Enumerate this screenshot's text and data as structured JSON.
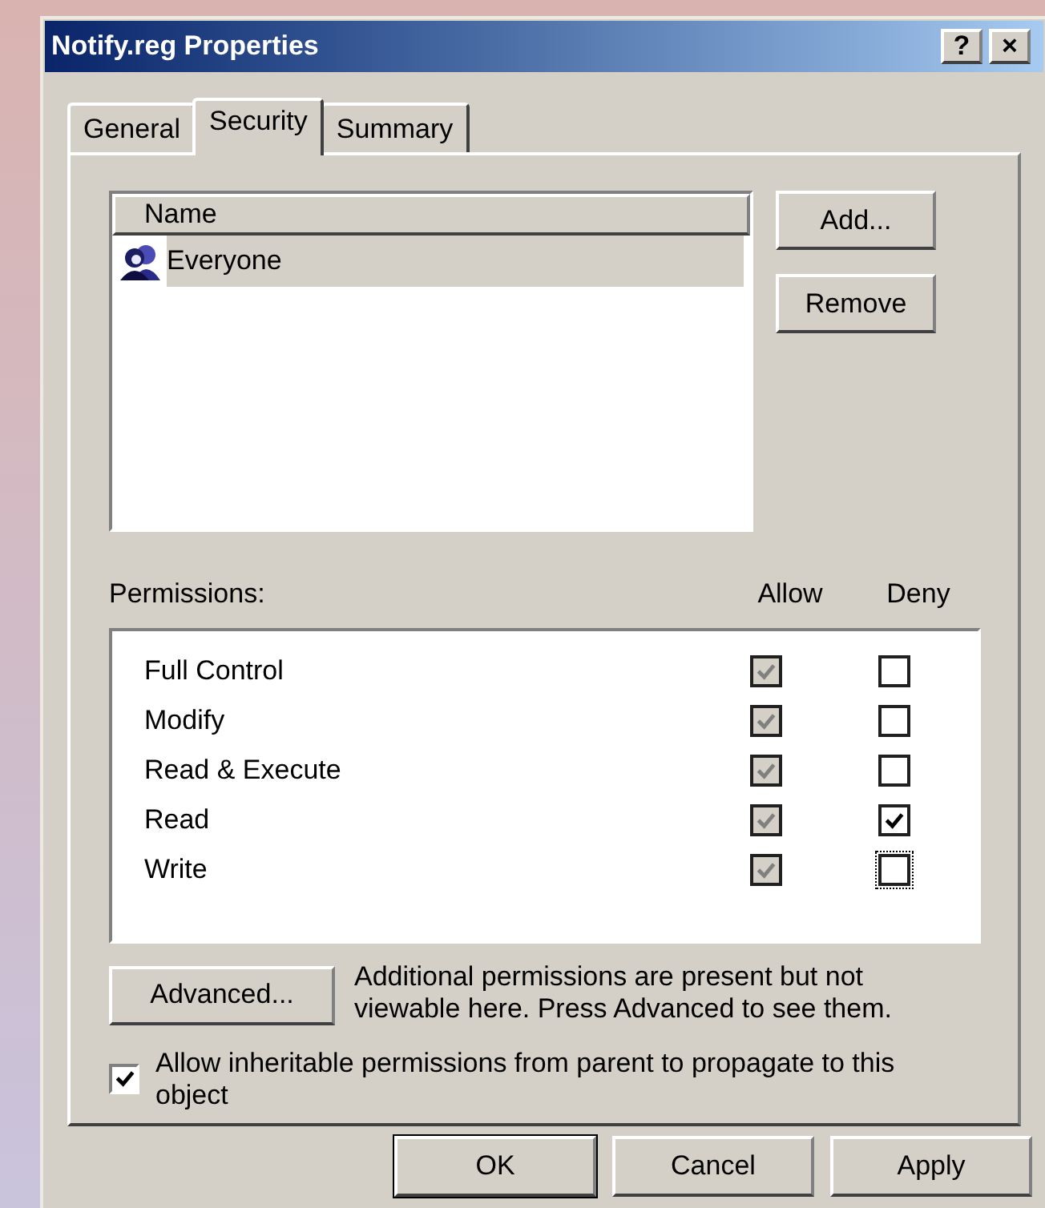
{
  "window": {
    "title": "Notify.reg Properties",
    "controls": [
      "?",
      "×"
    ]
  },
  "tabs": [
    {
      "label": "General",
      "selected": false
    },
    {
      "label": "Security",
      "selected": true
    },
    {
      "label": "Summary",
      "selected": false
    }
  ],
  "names": {
    "column": "Name",
    "items": [
      {
        "label": "Everyone",
        "selected": true
      }
    ]
  },
  "name_buttons": [
    "Add...",
    "Remove"
  ],
  "permissions": {
    "label": "Permissions:",
    "allow_heading": "Allow",
    "deny_heading": "Deny",
    "rows": [
      {
        "name": "Full Control",
        "allow": {
          "checked": true,
          "disabled": true
        },
        "deny": {
          "checked": false,
          "focused": false
        }
      },
      {
        "name": "Modify",
        "allow": {
          "checked": true,
          "disabled": true
        },
        "deny": {
          "checked": false,
          "focused": false
        }
      },
      {
        "name": "Read & Execute",
        "allow": {
          "checked": true,
          "disabled": true
        },
        "deny": {
          "checked": false,
          "focused": false
        }
      },
      {
        "name": "Read",
        "allow": {
          "checked": true,
          "disabled": true
        },
        "deny": {
          "checked": true,
          "focused": false
        }
      },
      {
        "name": "Write",
        "allow": {
          "checked": true,
          "disabled": true
        },
        "deny": {
          "checked": false,
          "focused": true
        }
      }
    ]
  },
  "advanced": {
    "button": "Advanced...",
    "note": "Additional permissions are present but not viewable here. Press Advanced to see them."
  },
  "inherit": {
    "label": "Allow inheritable permissions from parent to propagate to this object",
    "checked": true
  },
  "buttons": [
    {
      "label": "OK",
      "default": true
    },
    {
      "label": "Cancel",
      "default": false
    },
    {
      "label": "Apply",
      "default": false
    }
  ]
}
